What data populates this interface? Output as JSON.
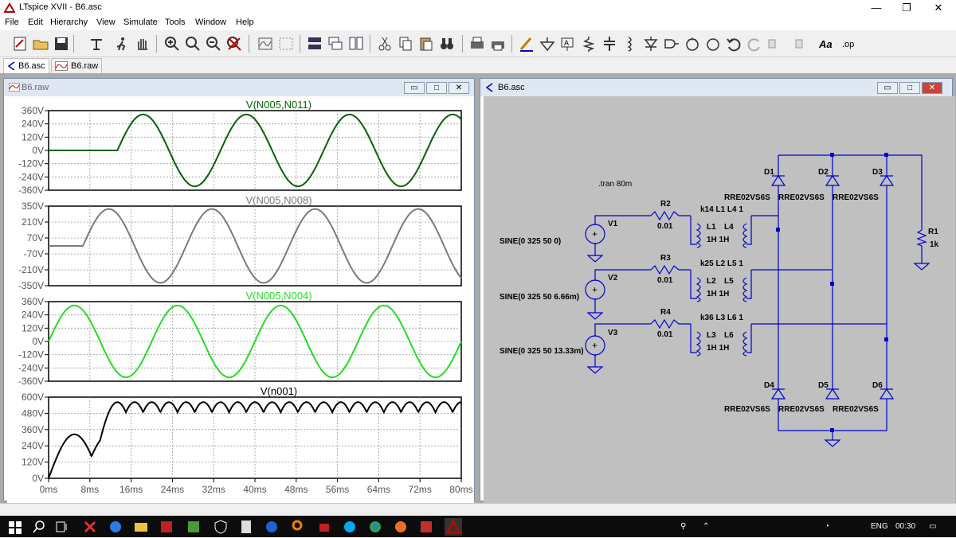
{
  "window": {
    "title": "LTspice XVII - B6.asc"
  },
  "menu": [
    "File",
    "Edit",
    "Hierarchy",
    "View",
    "Simulate",
    "Tools",
    "Window",
    "Help"
  ],
  "tabs": [
    {
      "label": "B6.asc"
    },
    {
      "label": "B6.raw"
    }
  ],
  "plot_window": {
    "title": "B6.raw"
  },
  "schematic_window": {
    "title": "B6.asc"
  },
  "colors": {
    "dark_green": "#006400",
    "gray": "#7a7a7a",
    "light_green": "#22dd22",
    "black": "#000000",
    "wire": "#0000cc",
    "schematic_bg": "#c0c0c0"
  },
  "chart_data": [
    {
      "type": "line",
      "title": "V(N005,N011)",
      "series": [
        {
          "name": "V(N005,N011)",
          "color": "#006400"
        }
      ],
      "ylim": [
        -360,
        360
      ],
      "yticks": [
        "360V",
        "240V",
        "120V",
        "0V",
        "-120V",
        "-240V",
        "-360V"
      ],
      "ytick_values": [
        360,
        240,
        120,
        0,
        -120,
        -240,
        -360
      ],
      "xlim": [
        0,
        80
      ],
      "amplitude": 325,
      "phase_deg": 0,
      "start_ms": 13.33
    },
    {
      "type": "line",
      "title": "V(N005,N008)",
      "series": [
        {
          "name": "V(N005,N008)",
          "color": "#7a7a7a"
        }
      ],
      "ylim": [
        -350,
        350
      ],
      "yticks": [
        "350V",
        "210V",
        "70V",
        "-70V",
        "-210V",
        "-350V"
      ],
      "ytick_values": [
        350,
        210,
        70,
        -70,
        -210,
        -350
      ],
      "xlim": [
        0,
        80
      ],
      "amplitude": 325,
      "phase_deg": 120,
      "start_ms": 6.66
    },
    {
      "type": "line",
      "title": "V(N005,N004)",
      "series": [
        {
          "name": "V(N005,N004)",
          "color": "#22dd22"
        }
      ],
      "ylim": [
        -360,
        360
      ],
      "yticks": [
        "360V",
        "240V",
        "120V",
        "0V",
        "-120V",
        "-240V",
        "-360V"
      ],
      "ytick_values": [
        360,
        240,
        120,
        0,
        -120,
        -240,
        -360
      ],
      "xlim": [
        0,
        80
      ],
      "amplitude": 325,
      "phase_deg": 240,
      "start_ms": 0
    },
    {
      "type": "line",
      "title": "V(n001)",
      "series": [
        {
          "name": "V(n001)",
          "color": "#000000"
        }
      ],
      "ylim": [
        0,
        600
      ],
      "yticks": [
        "600V",
        "480V",
        "360V",
        "240V",
        "120V",
        "0V"
      ],
      "ytick_values": [
        600,
        480,
        360,
        240,
        120,
        0
      ],
      "xlim": [
        0,
        80
      ],
      "xticks": [
        "0ms",
        "8ms",
        "16ms",
        "24ms",
        "32ms",
        "40ms",
        "48ms",
        "56ms",
        "64ms",
        "72ms",
        "80ms"
      ],
      "xtick_values": [
        0,
        8,
        16,
        24,
        32,
        40,
        48,
        56,
        64,
        72,
        80
      ],
      "amplitude": 325
    }
  ],
  "schematic": {
    "directive": ".tran 80m",
    "sources": [
      {
        "name": "V1",
        "value": "SINE(0 325 50 0)"
      },
      {
        "name": "V2",
        "value": "SINE(0 325 50 6.66m)"
      },
      {
        "name": "V3",
        "value": "SINE(0 325 50 13.33m)"
      }
    ],
    "resistors": [
      {
        "name": "R2",
        "value": "0.01"
      },
      {
        "name": "R3",
        "value": "0.01"
      },
      {
        "name": "R4",
        "value": "0.01"
      }
    ],
    "couplings": [
      "k14 L1 L4 1",
      "k25 L2 L5 1",
      "k36 L3 L6 1"
    ],
    "inductors": [
      {
        "a": "L1",
        "b": "L4",
        "values": "1H 1H"
      },
      {
        "a": "L2",
        "b": "L5",
        "values": "1H 1H"
      },
      {
        "a": "L3",
        "b": "L6",
        "values": "1H 1H"
      }
    ],
    "diodes_top": [
      "D1",
      "D2",
      "D3"
    ],
    "diodes_bottom": [
      "D4",
      "D5",
      "D6"
    ],
    "diode_model": "RRE02VS6S",
    "load": {
      "name": "R1",
      "value": "1k"
    }
  },
  "taskbar": {
    "lang": "ENG",
    "clock": "00:30"
  }
}
